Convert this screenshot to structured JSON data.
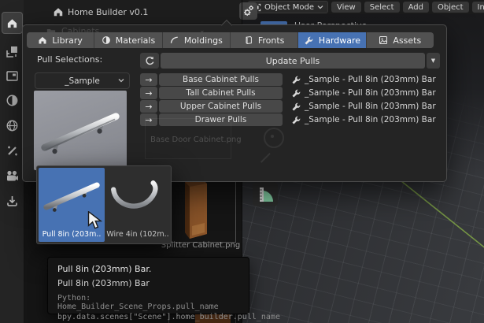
{
  "colors": {
    "accent_blue": "#4772b3",
    "axis_green": "#7c9f45",
    "dash_orange": "#e8862d",
    "preview_grey": "#94969d"
  },
  "sidebar": {
    "icons": [
      "home",
      "select-box",
      "panel",
      "material-sphere",
      "world",
      "magic-wand",
      "camera",
      "download"
    ]
  },
  "header": {
    "title": "Home Builder v0.1"
  },
  "viewport": {
    "mode_dropdown": "Object Mode",
    "menus": [
      "View",
      "Select",
      "Add",
      "Object",
      "Interface"
    ],
    "perspective_label": "User Perspective"
  },
  "popup": {
    "ghost_collection_label": "Cabinets",
    "tabs": [
      {
        "label": "Library",
        "icon": "home-icon",
        "active": false
      },
      {
        "label": "Materials",
        "icon": "material-icon",
        "active": false
      },
      {
        "label": "Moldings",
        "icon": "curve-icon",
        "active": false
      },
      {
        "label": "Fronts",
        "icon": "panel-icon",
        "active": false
      },
      {
        "label": "Hardware",
        "icon": "wrench-icon",
        "active": true
      },
      {
        "label": "Assets",
        "icon": "image-icon",
        "active": false
      }
    ],
    "pull_selections_label": "Pull Selections:",
    "sample_dropdown_value": "_Sample",
    "update_button_label": "Update Pulls",
    "rows": [
      {
        "button": "Base Cabinet Pulls",
        "value": "_Sample - Pull 8in (203mm) Bar"
      },
      {
        "button": "Tall Cabinet Pulls",
        "value": "_Sample - Pull 8in (203mm) Bar"
      },
      {
        "button": "Upper Cabinet Pulls",
        "value": "_Sample - Pull 8in (203mm) Bar"
      },
      {
        "button": "Drawer Pulls",
        "value": "_Sample - Pull 8in (203mm) Bar"
      }
    ]
  },
  "gallery": {
    "items": [
      {
        "label": "Pull 8in (203m..",
        "selected": true,
        "image": "bar-pull"
      },
      {
        "label": "Wire 4in (102m..",
        "selected": false,
        "image": "wire-pull"
      }
    ]
  },
  "tooltip": {
    "title": "Pull 8in (203mm) Bar.",
    "subtitle": "Pull 8in (203mm) Bar",
    "python_label": "Python: Home_Builder_Scene_Props.pull_name",
    "python_path": "bpy.data.scenes[\"Scene\"].home_builder.pull_name"
  },
  "asset_browser": {
    "ghost_thumbnail_label": "Base Door Cabinet.png",
    "thumbnail_label": "Splitter Cabinet.png"
  }
}
